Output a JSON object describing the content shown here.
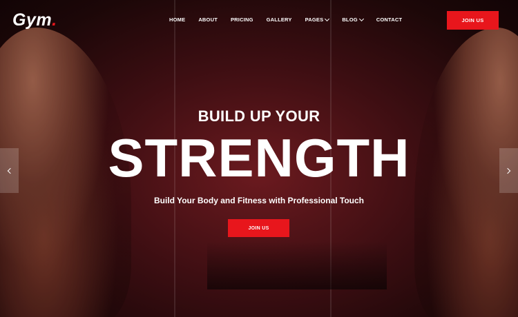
{
  "brand": {
    "logo_text": "Gym",
    "logo_dot": ".",
    "accent_color": "#e8161c"
  },
  "nav": {
    "items": [
      {
        "label": "HOME",
        "has_dropdown": false
      },
      {
        "label": "ABOUT",
        "has_dropdown": false
      },
      {
        "label": "PRICING",
        "has_dropdown": false
      },
      {
        "label": "GALLERY",
        "has_dropdown": false
      },
      {
        "label": "PAGES",
        "has_dropdown": true
      },
      {
        "label": "BLOG",
        "has_dropdown": true
      },
      {
        "label": "CONTACT",
        "has_dropdown": false
      }
    ],
    "cta_label": "JOIN US"
  },
  "hero": {
    "pre_title": "BUILD UP YOUR",
    "title": "STRENGTH",
    "tagline": "Build Your Body and Fitness with Professional Touch",
    "cta_label": "JOIN US",
    "prev_icon": "chevron-left-icon",
    "next_icon": "chevron-right-icon"
  }
}
